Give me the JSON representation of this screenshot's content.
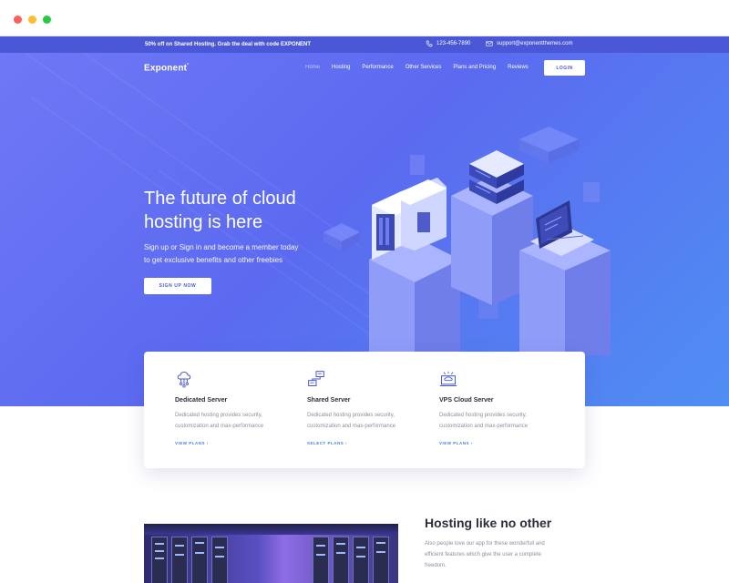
{
  "topbar": {
    "promo": "50% off on Shared Hosting. Grab the deal with code EXPONENT",
    "phone": "123-456-7890",
    "email": "support@exponentthemes.com"
  },
  "header": {
    "logo": "Exponent",
    "nav": [
      "Home",
      "Hosting",
      "Performance",
      "Other Services",
      "Plans and Pricing",
      "Reviews"
    ],
    "login_label": "LOGIN"
  },
  "hero": {
    "title_line1": "The future of cloud",
    "title_line2": "hosting is here",
    "subtitle_line1": "Sign up or Sign in and become a member today",
    "subtitle_line2": "to get exclusive benefits and other freebies",
    "cta_label": "SIGN UP NOW"
  },
  "features": [
    {
      "icon": "cloud-network-icon",
      "title": "Dedicated Server",
      "desc_line1": "Dedicated hosting provides security,",
      "desc_line2": "customization and max-performance",
      "link": "VIEW PLANS ›"
    },
    {
      "icon": "network-servers-icon",
      "title": "Shared Server",
      "desc_line1": "Dedicated hosting provides security,",
      "desc_line2": "customization and max-performance",
      "link": "SELECT PLANS ›"
    },
    {
      "icon": "vps-cloud-icon",
      "title": "VPS Cloud Server",
      "desc_line1": "Dedicated hosting provides security,",
      "desc_line2": "customization and max-performance",
      "link": "VIEW PLANS ›"
    }
  ],
  "section": {
    "title": "Hosting like no other",
    "desc_line1": "Also people love our app for these wonderfull and",
    "desc_line2": "efficient features which give the user a complete",
    "desc_line3": "freedom."
  },
  "colors": {
    "brand": "#4a57d6",
    "hero_gradient_start": "#6f78f6",
    "hero_gradient_end": "#4f8ef3",
    "link": "#4a7df0"
  }
}
